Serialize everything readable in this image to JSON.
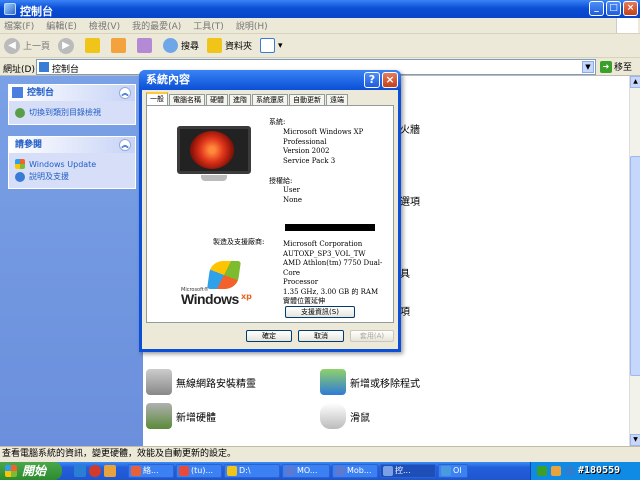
{
  "window": {
    "title": "控制台",
    "min": "_",
    "max": "□",
    "close": "×"
  },
  "menu": [
    "檔案(F)",
    "編輯(E)",
    "檢視(V)",
    "我的最愛(A)",
    "工具(T)",
    "說明(H)"
  ],
  "toolbar": {
    "back": "上一頁",
    "search": "搜尋",
    "folders": "資料夾"
  },
  "address": {
    "label": "網址(D)",
    "value": "控制台",
    "go": "移至"
  },
  "taskpane": {
    "panel_head": "控制台",
    "switch_link": "切換到類別目錄檢視",
    "see_also_head": "請參閱",
    "links": [
      "Windows Update",
      "說明及支援"
    ]
  },
  "background_items": {
    "r1": "火牆",
    "r2": "選項",
    "r3": "具",
    "r4": "項",
    "wireless": "無線網路安裝精靈",
    "add_remove": "新增或移除程式",
    "add_hw": "新增硬體",
    "mouse": "滑鼠"
  },
  "status": "查看電腦系統的資訊，變更硬體，效能及自動更新的設定。",
  "taskbar": {
    "start": "開始",
    "tasks": [
      "絡...",
      "(tu)...",
      "D:\\",
      "MO...",
      "Mob...",
      "控...",
      "Ol"
    ],
    "watermark": "#180559"
  },
  "dialog": {
    "title": "系統內容",
    "help": "?",
    "close": "×",
    "tabs": [
      "一般",
      "電腦名稱",
      "硬體",
      "進階",
      "系統還原",
      "自動更新",
      "遠端"
    ],
    "system_label": "系統:",
    "system_lines": [
      "Microsoft Windows XP",
      "Professional",
      "Version 2002",
      "Service Pack 3"
    ],
    "registered_label": "授權給:",
    "registered_lines": [
      "User",
      "None"
    ],
    "manufacturer_label": "製造及支援廠商:",
    "computer_lines": [
      "Microsoft Corporation",
      "AUTOXP_SP3_VOL_TW",
      "AMD Athlon(tm) 7750 Dual-Core",
      "Processor",
      "1.35 GHz, 3.00 GB 的 RAM",
      "實體位置延伸"
    ],
    "support_button": "支援資訊(S)",
    "logo_ms": "Microsoft®",
    "logo_windows": "Windows",
    "logo_xp": "xp",
    "ok": "確定",
    "cancel": "取消",
    "apply": "套用(A)"
  },
  "colors": {
    "titlebar": "#0a4fd6",
    "taskpane": "#6b8fdc",
    "start": "#2d8a2d"
  }
}
